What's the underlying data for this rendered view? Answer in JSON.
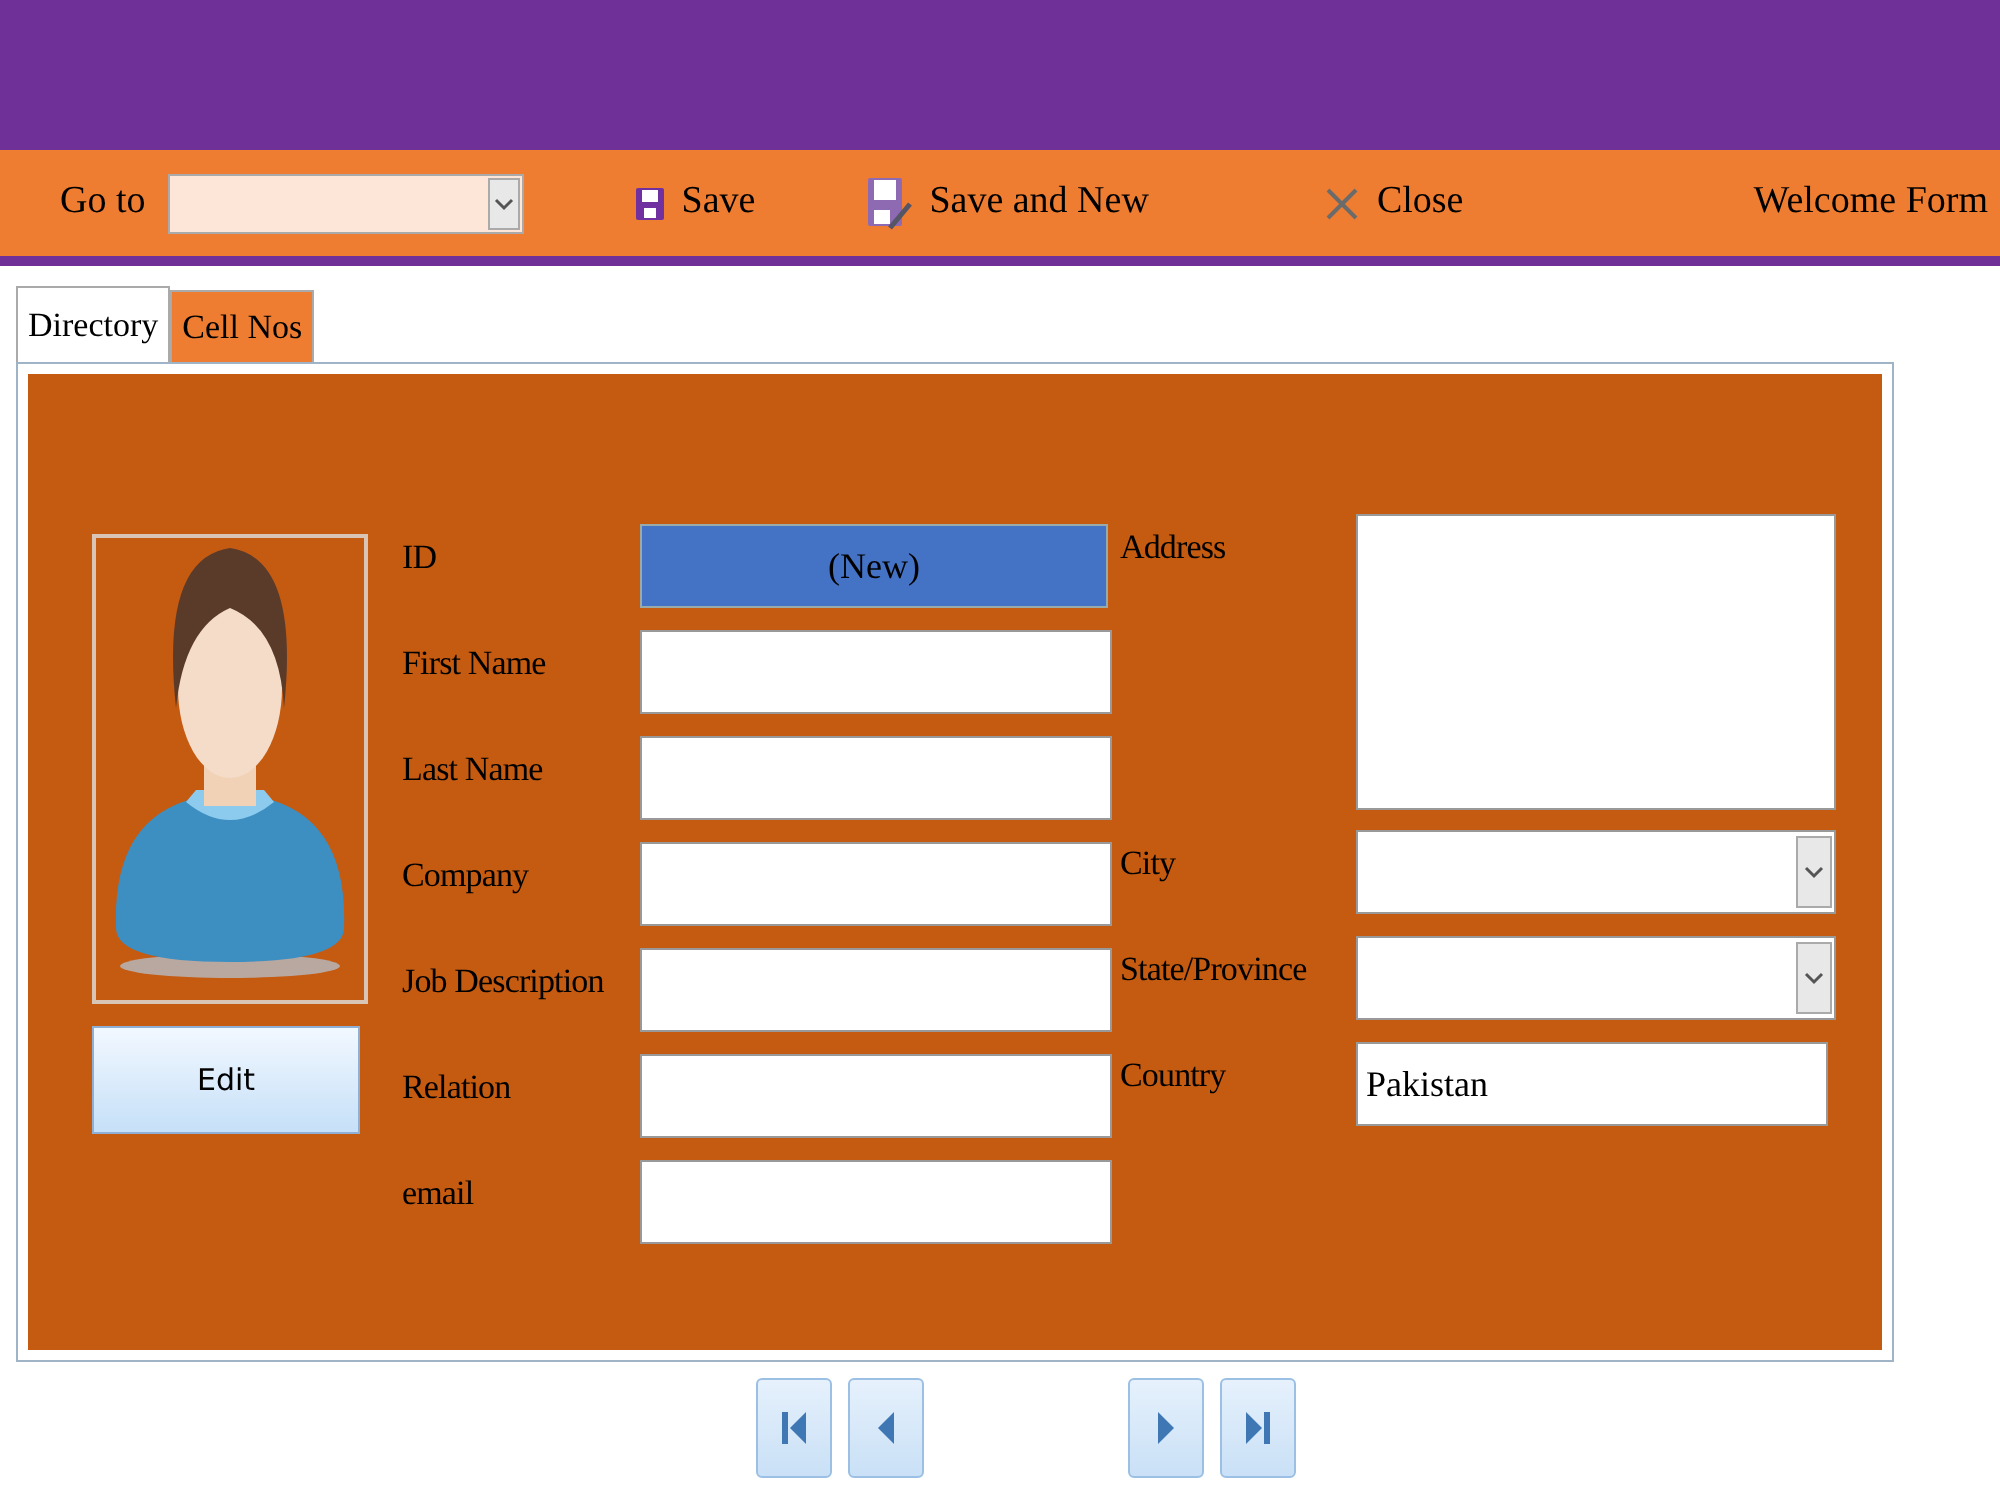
{
  "toolbar": {
    "goto": {
      "label": "Go to"
    },
    "buttons": [
      {
        "label": "Save",
        "kind": "save"
      },
      {
        "label": "Save and New",
        "kind": "save_new"
      },
      {
        "label": "Close",
        "kind": "close"
      }
    ],
    "form_title": "Welcome Form"
  },
  "tabs": [
    {
      "label": "Directory",
      "selected": true
    },
    {
      "label": "Cell Nos",
      "selected": false
    }
  ],
  "photo_button": "Edit",
  "left_fields": [
    {
      "label": "ID",
      "kind": "readonly",
      "value": "(New)"
    },
    {
      "label": "First Name",
      "kind": "text"
    },
    {
      "label": "Last Name",
      "kind": "text"
    },
    {
      "label": "Company",
      "kind": "text"
    },
    {
      "label": "Job Description",
      "kind": "text"
    },
    {
      "label": "Relation",
      "kind": "text"
    },
    {
      "label": "email",
      "kind": "text"
    }
  ],
  "right_fields": [
    {
      "label": "Address",
      "kind": "textarea"
    },
    {
      "label": "City",
      "kind": "dropdown"
    },
    {
      "label": "State/Province",
      "kind": "dropdown"
    },
    {
      "label": "Country",
      "kind": "text",
      "value": "Pakistan"
    }
  ],
  "navigation": [
    {
      "kind": "first"
    },
    {
      "kind": "previous"
    },
    {
      "kind": "next"
    },
    {
      "kind": "last"
    }
  ]
}
